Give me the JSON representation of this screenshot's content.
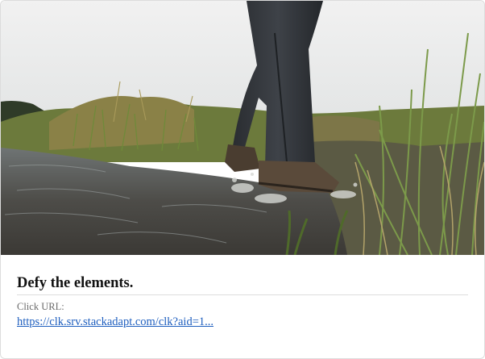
{
  "ad": {
    "image_alt": "hiker stepping through a stream in waterproof boots",
    "headline": "Defy the elements.",
    "click_url_label": "Click URL:",
    "click_url_text": "https://clk.srv.stackadapt.com/clk?aid=1..."
  }
}
